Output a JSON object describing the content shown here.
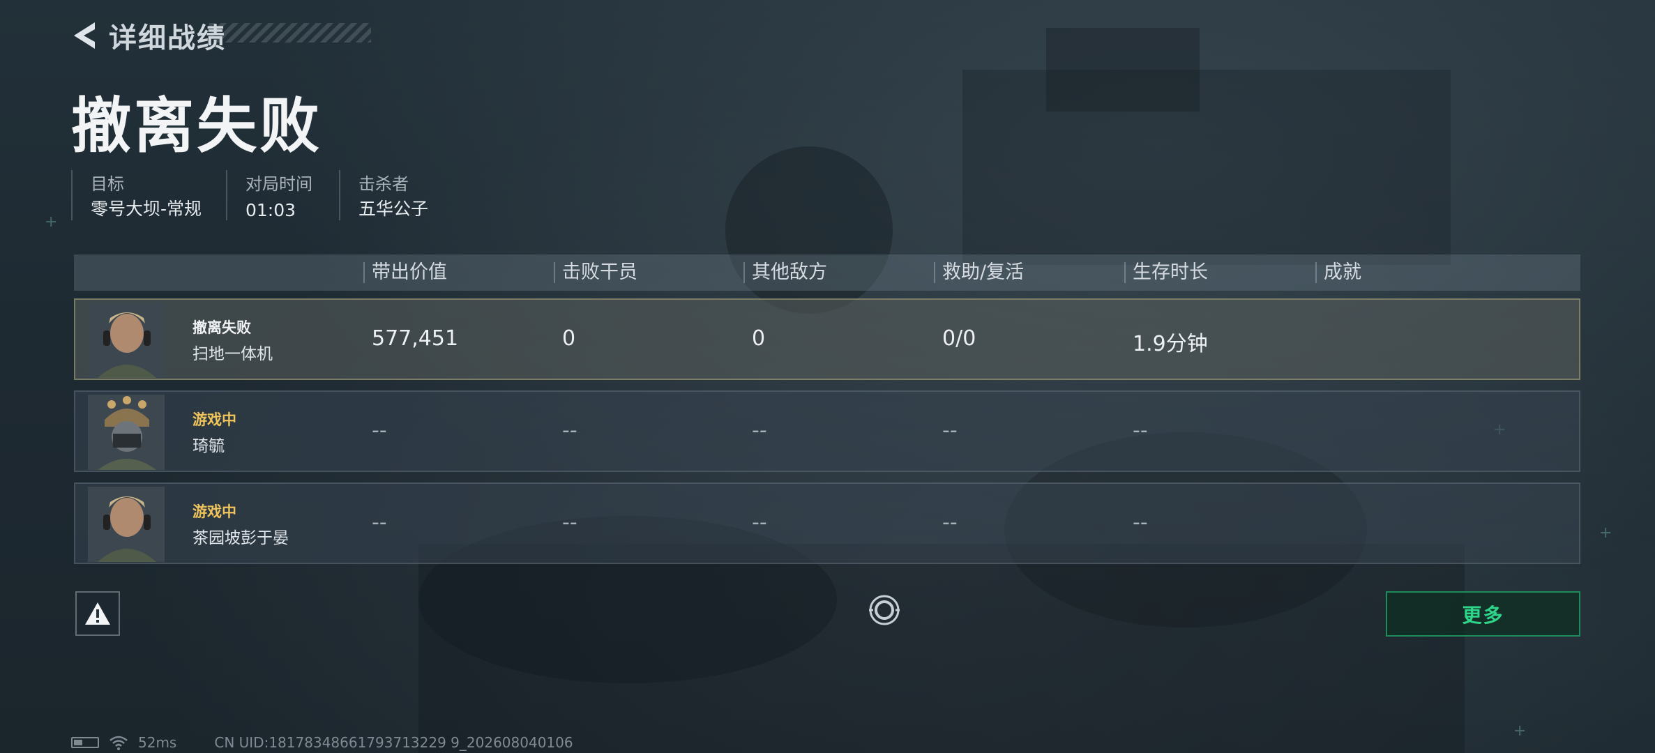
{
  "header": {
    "back_title": "详细战绩",
    "result_title": "撤离失败"
  },
  "match_info": [
    {
      "label": "目标",
      "value": "零号大坝-常规"
    },
    {
      "label": "对局时间",
      "value": "01:03"
    },
    {
      "label": "击杀者",
      "value": "五华公子"
    }
  ],
  "table": {
    "columns": [
      "带出价值",
      "击败干员",
      "其他敌方",
      "救助/复活",
      "生存时长",
      "成就"
    ],
    "rows": [
      {
        "status": "撤离失败",
        "status_type": "self",
        "name": "扫地一体机",
        "values": [
          "577,451",
          "0",
          "0",
          "0/0",
          "1.9分钟",
          ""
        ]
      },
      {
        "status": "游戏中",
        "status_type": "ingame",
        "name": "琦毓",
        "values": [
          "--",
          "--",
          "--",
          "--",
          "--",
          ""
        ]
      },
      {
        "status": "游戏中",
        "status_type": "ingame",
        "name": "茶园坡彭于晏",
        "values": [
          "--",
          "--",
          "--",
          "--",
          "--",
          ""
        ]
      }
    ]
  },
  "actions": {
    "warn_icon": "warning-icon",
    "center_icon": "target-icon",
    "more_label": "更多"
  },
  "footer": {
    "ping": "52ms",
    "uid": "CN UID:18178348661793713229 9_202608040106"
  },
  "colors": {
    "accent_green": "#2fd68a",
    "in_game_yellow": "#f0c45a"
  }
}
